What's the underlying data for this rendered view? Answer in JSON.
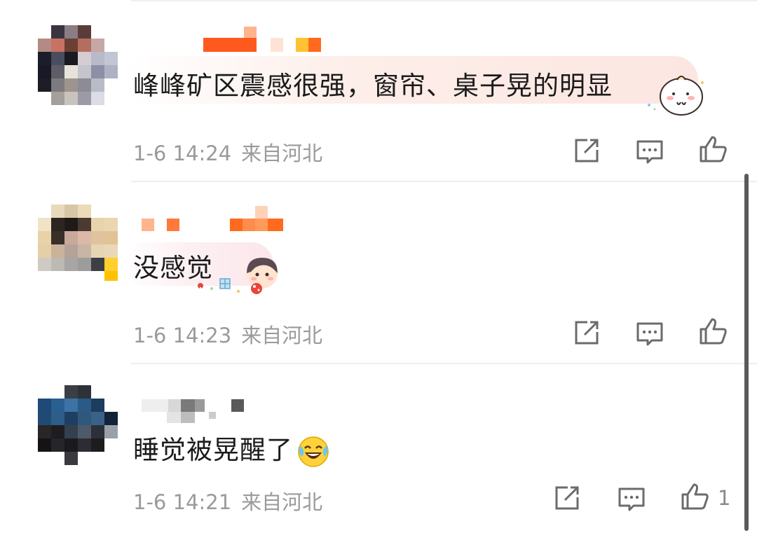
{
  "comments": [
    {
      "content": "峰峰矿区震感很强，窗帘、桌子晃的明显",
      "time": "1-6 14:24",
      "source": "来自河北",
      "like_count": ""
    },
    {
      "content": "没感觉",
      "time": "1-6 14:23",
      "source": "来自河北",
      "like_count": ""
    },
    {
      "content": "睡觉被晃醒了",
      "time": "1-6 14:21",
      "source": "来自河北",
      "like_count": "1"
    }
  ],
  "icons": {
    "share": "share-icon",
    "reply": "comment-icon",
    "like": "thumbs-up-icon",
    "emoji": "laughing-crying-emoji"
  },
  "colors": {
    "username_orange": "#ff6a00",
    "meta_gray": "#9a9a9a",
    "icon_gray": "#6b6b6b",
    "bubble_pink": "#fdebe6"
  }
}
